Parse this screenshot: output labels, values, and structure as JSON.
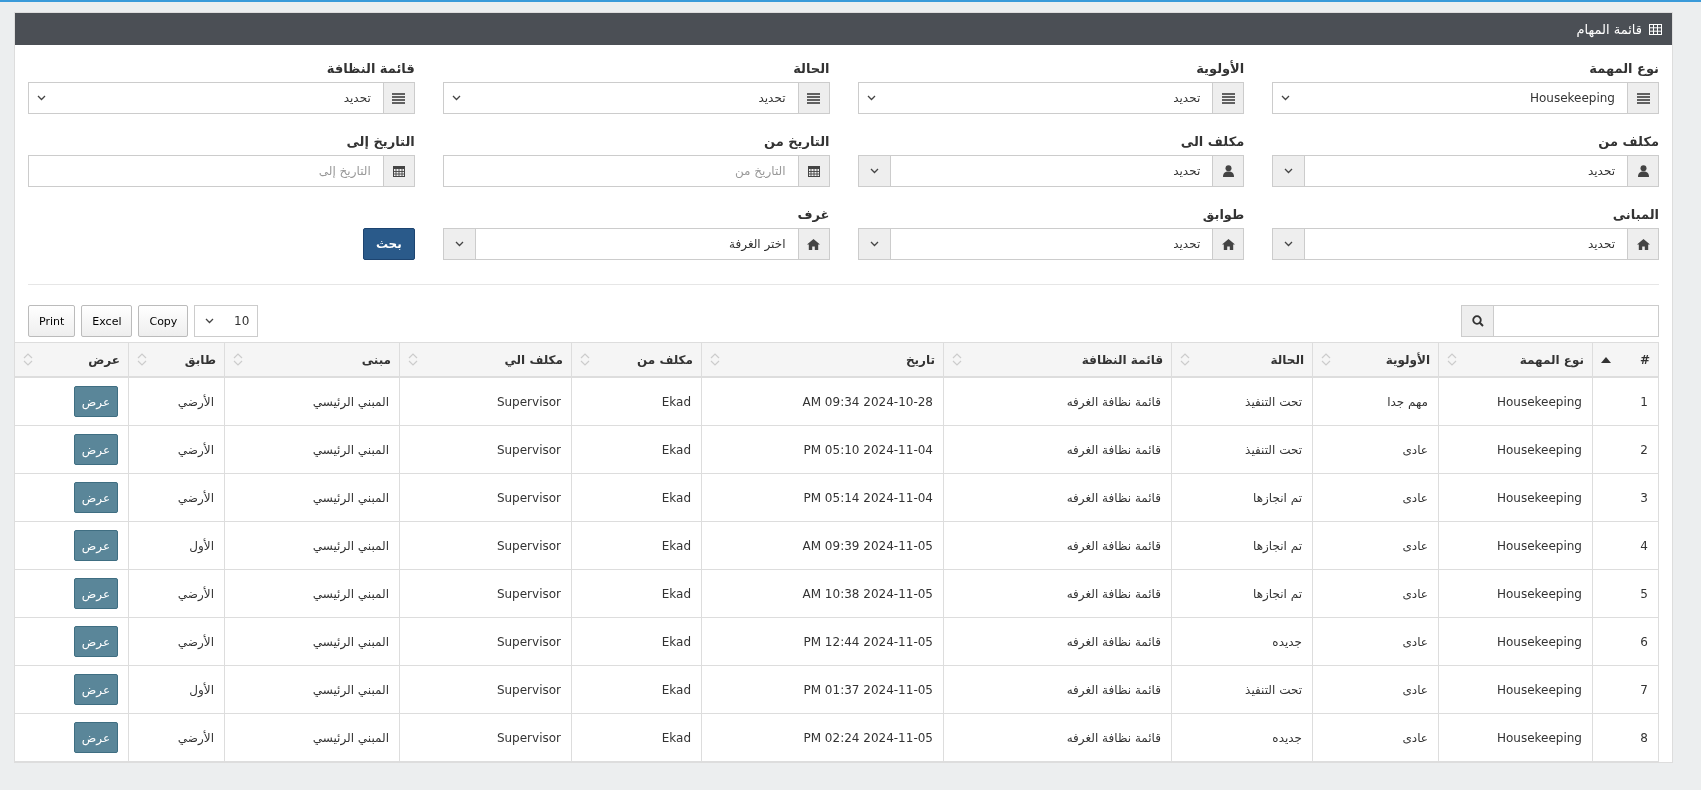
{
  "panel": {
    "title": "قائمة المهام"
  },
  "filters": [
    {
      "kind": "select",
      "label": "نوع المهمة",
      "value": "Housekeeping"
    },
    {
      "kind": "select",
      "label": "الأولوية",
      "value": "تحديد"
    },
    {
      "kind": "select",
      "label": "الحالة",
      "value": "تحديد"
    },
    {
      "kind": "select",
      "label": "قائمة النظافة",
      "value": "تحديد"
    },
    {
      "kind": "combo",
      "label": "مكلف من",
      "value": "تحديد"
    },
    {
      "kind": "combo",
      "label": "مكلف الى",
      "value": "تحديد"
    },
    {
      "kind": "date",
      "label": "التاريخ من",
      "placeholder": "التاريخ من"
    },
    {
      "kind": "date",
      "label": "التاريخ إلى",
      "placeholder": "التاريخ إلى"
    },
    {
      "kind": "combo",
      "label": "المبانى",
      "value": "تحديد"
    },
    {
      "kind": "combo",
      "label": "طوابق",
      "value": "تحديد"
    },
    {
      "kind": "combo",
      "label": "غرف",
      "value": "اختر الغرفة"
    }
  ],
  "search_button": "بحث",
  "toolbar": {
    "page_length": "10",
    "buttons": [
      "Copy",
      "Excel",
      "Print"
    ]
  },
  "table": {
    "columns": [
      {
        "label": "#",
        "sorted": true
      },
      {
        "label": "نوع المهمة",
        "sorted": false
      },
      {
        "label": "الأولوية",
        "sorted": false
      },
      {
        "label": "الحالة",
        "sorted": false
      },
      {
        "label": "قائمة النظافة",
        "sorted": false
      },
      {
        "label": "تاريخ",
        "sorted": false
      },
      {
        "label": "مكلف من",
        "sorted": false
      },
      {
        "label": "مكلف الي",
        "sorted": false
      },
      {
        "label": "مبنى",
        "sorted": false
      },
      {
        "label": "طابق",
        "sorted": false
      },
      {
        "label": "عرض",
        "sorted": false
      }
    ],
    "rows": [
      {
        "cells": [
          "1",
          "Housekeeping",
          "مهم جدا",
          "تحت التنفيذ",
          "قائمة نظافة الغرفه",
          "AM 09:34 2024-10-28",
          "Ekad",
          "Supervisor",
          "المبني الرئيسي",
          "الأرضي"
        ],
        "action": "عرض"
      },
      {
        "cells": [
          "2",
          "Housekeeping",
          "عادى",
          "تحت التنفيذ",
          "قائمة نظافة الغرفه",
          "PM 05:10 2024-11-04",
          "Ekad",
          "Supervisor",
          "المبني الرئيسي",
          "الأرضي"
        ],
        "action": "عرض"
      },
      {
        "cells": [
          "3",
          "Housekeeping",
          "عادى",
          "تم انجازها",
          "قائمة نظافة الغرفه",
          "PM 05:14 2024-11-04",
          "Ekad",
          "Supervisor",
          "المبني الرئيسي",
          "الأرضي"
        ],
        "action": "عرض"
      },
      {
        "cells": [
          "4",
          "Housekeeping",
          "عادى",
          "تم انجازها",
          "قائمة نظافة الغرفه",
          "AM 09:39 2024-11-05",
          "Ekad",
          "Supervisor",
          "المبني الرئيسي",
          "الأول"
        ],
        "action": "عرض"
      },
      {
        "cells": [
          "5",
          "Housekeeping",
          "عادى",
          "تم انجازها",
          "قائمة نظافة الغرفه",
          "AM 10:38 2024-11-05",
          "Ekad",
          "Supervisor",
          "المبني الرئيسي",
          "الأرضي"
        ],
        "action": "عرض"
      },
      {
        "cells": [
          "6",
          "Housekeeping",
          "عادى",
          "جديده",
          "قائمة نظافة الغرفه",
          "PM 12:44 2024-11-05",
          "Ekad",
          "Supervisor",
          "المبني الرئيسي",
          "الأرضي"
        ],
        "action": "عرض"
      },
      {
        "cells": [
          "7",
          "Housekeeping",
          "عادى",
          "تحت التنفيذ",
          "قائمة نظافة الغرفه",
          "PM 01:37 2024-11-05",
          "Ekad",
          "Supervisor",
          "المبني الرئيسي",
          "الأول"
        ],
        "action": "عرض"
      },
      {
        "cells": [
          "8",
          "Housekeeping",
          "عادى",
          "جديده",
          "قائمة نظافة الغرفه",
          "PM 02:24 2024-11-05",
          "Ekad",
          "Supervisor",
          "المبني الرئيسي",
          "الأرضي"
        ],
        "action": "عرض"
      }
    ]
  }
}
